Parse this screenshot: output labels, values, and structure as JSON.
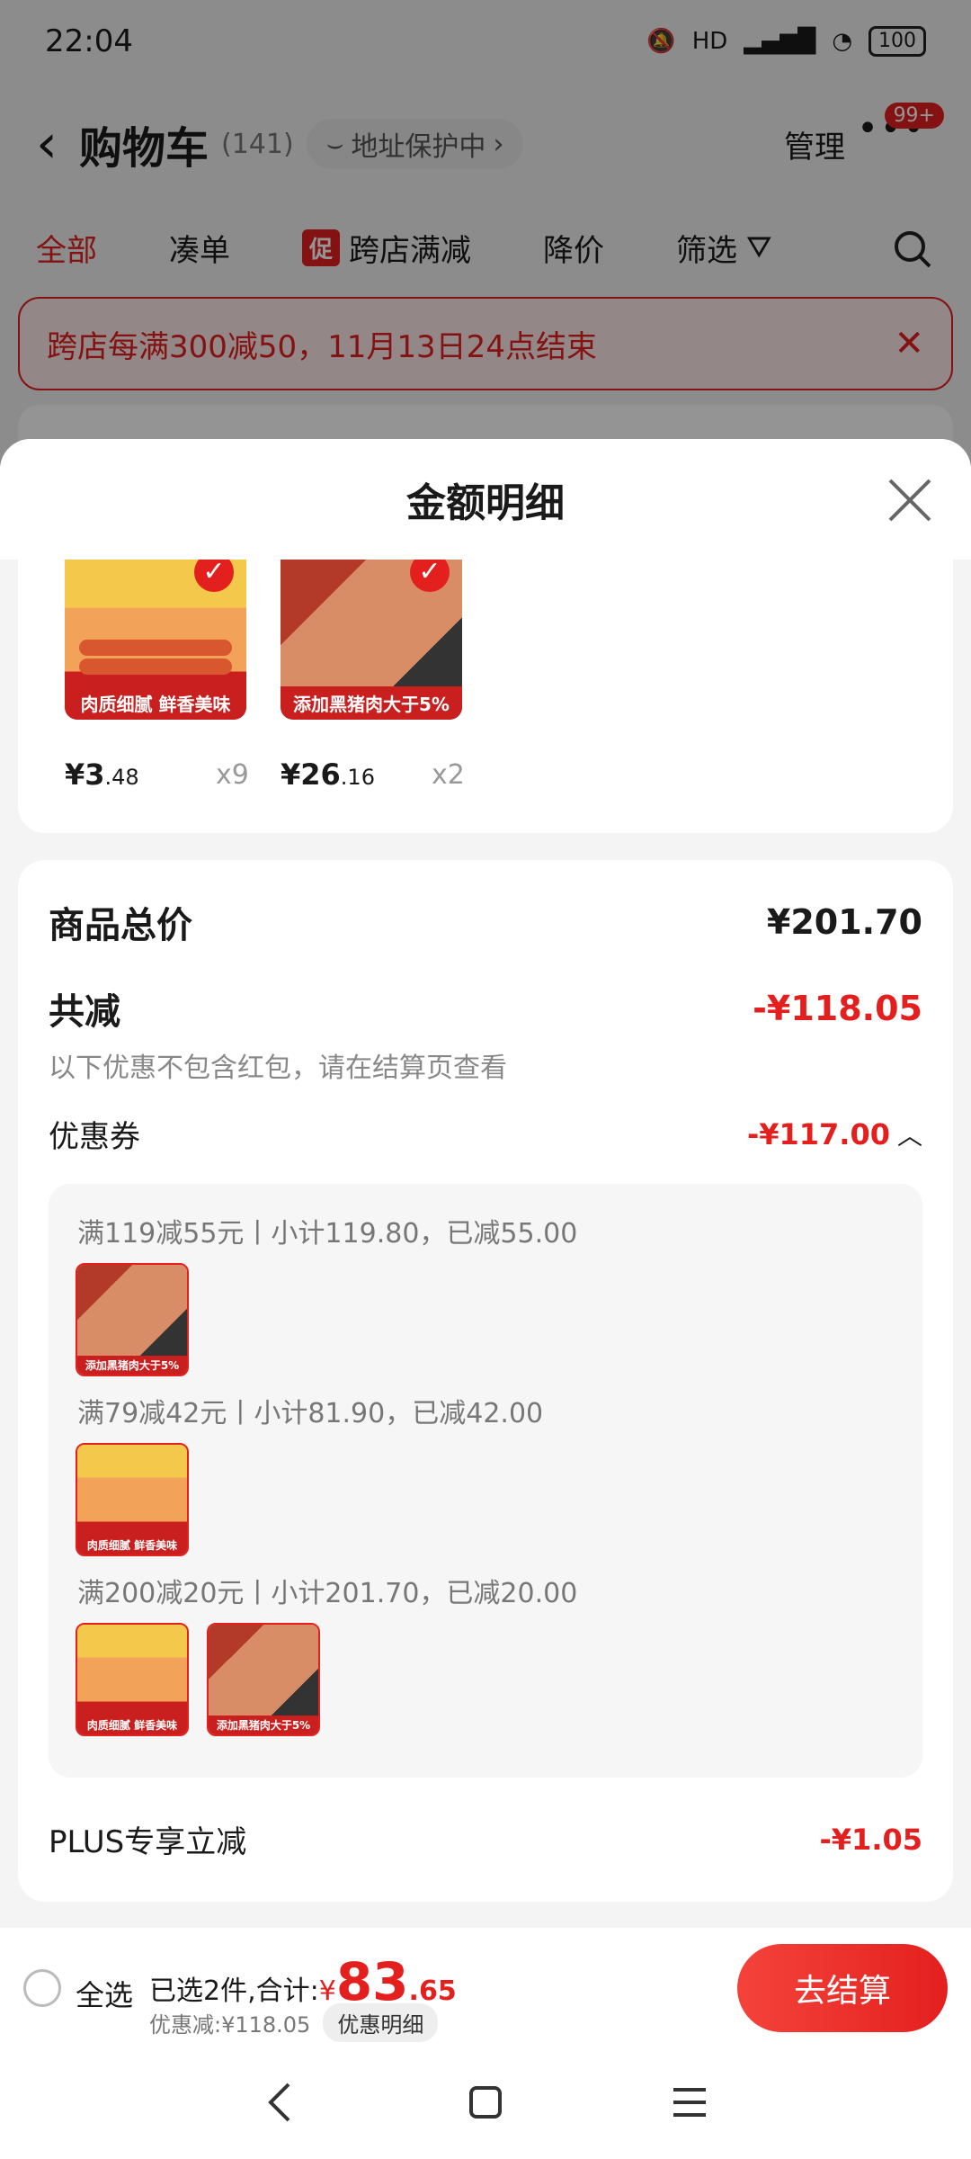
{
  "status_bar": {
    "time": "22:04",
    "network": "HD",
    "battery": "100"
  },
  "cart": {
    "title": "购物车",
    "count": "(141)",
    "address": "地址保护中",
    "manage": "管理",
    "badge": "99+",
    "tabs": [
      "全部",
      "凑单",
      "跨店满减",
      "降价",
      "筛选"
    ],
    "promo_tag": "促",
    "notice": "跨店每满300减50，11月13日24点结束"
  },
  "sheet": {
    "title": "金额明细",
    "items": [
      {
        "label": "肉质细腻 鲜香美味",
        "price_int": "¥3",
        "price_dec": ".48",
        "qty": "x9",
        "icon": "sausage-thumb"
      },
      {
        "label": "添加黑猪肉大于5%",
        "price_int": "¥26",
        "price_dec": ".16",
        "qty": "x2",
        "icon": "ham-thumb"
      }
    ],
    "total_label": "商品总价",
    "total_value": "¥201.70",
    "reduce_label": "共减",
    "reduce_value": "-¥118.05",
    "reduce_note": "以下优惠不包含红包，请在结算页查看",
    "coupon_label": "优惠券",
    "coupon_value": "-¥117.00",
    "coupons": [
      {
        "text": "满119减55元丨小计119.80，已减55.00"
      },
      {
        "text": "满79减42元丨小计81.90，已减42.00"
      },
      {
        "text": "满200减20元丨小计201.70，已减20.00"
      }
    ],
    "plus_label": "PLUS专享立减",
    "plus_value": "-¥1.05"
  },
  "bottom": {
    "select_all": "全选",
    "selected": "已选2件,合计:",
    "currency": "¥",
    "sum_int": "83",
    "sum_dec": ".65",
    "discount": "优惠减:¥118.05",
    "detail_btn": "优惠明细",
    "checkout": "去结算"
  },
  "colors": {
    "accent": "#e4201f"
  }
}
